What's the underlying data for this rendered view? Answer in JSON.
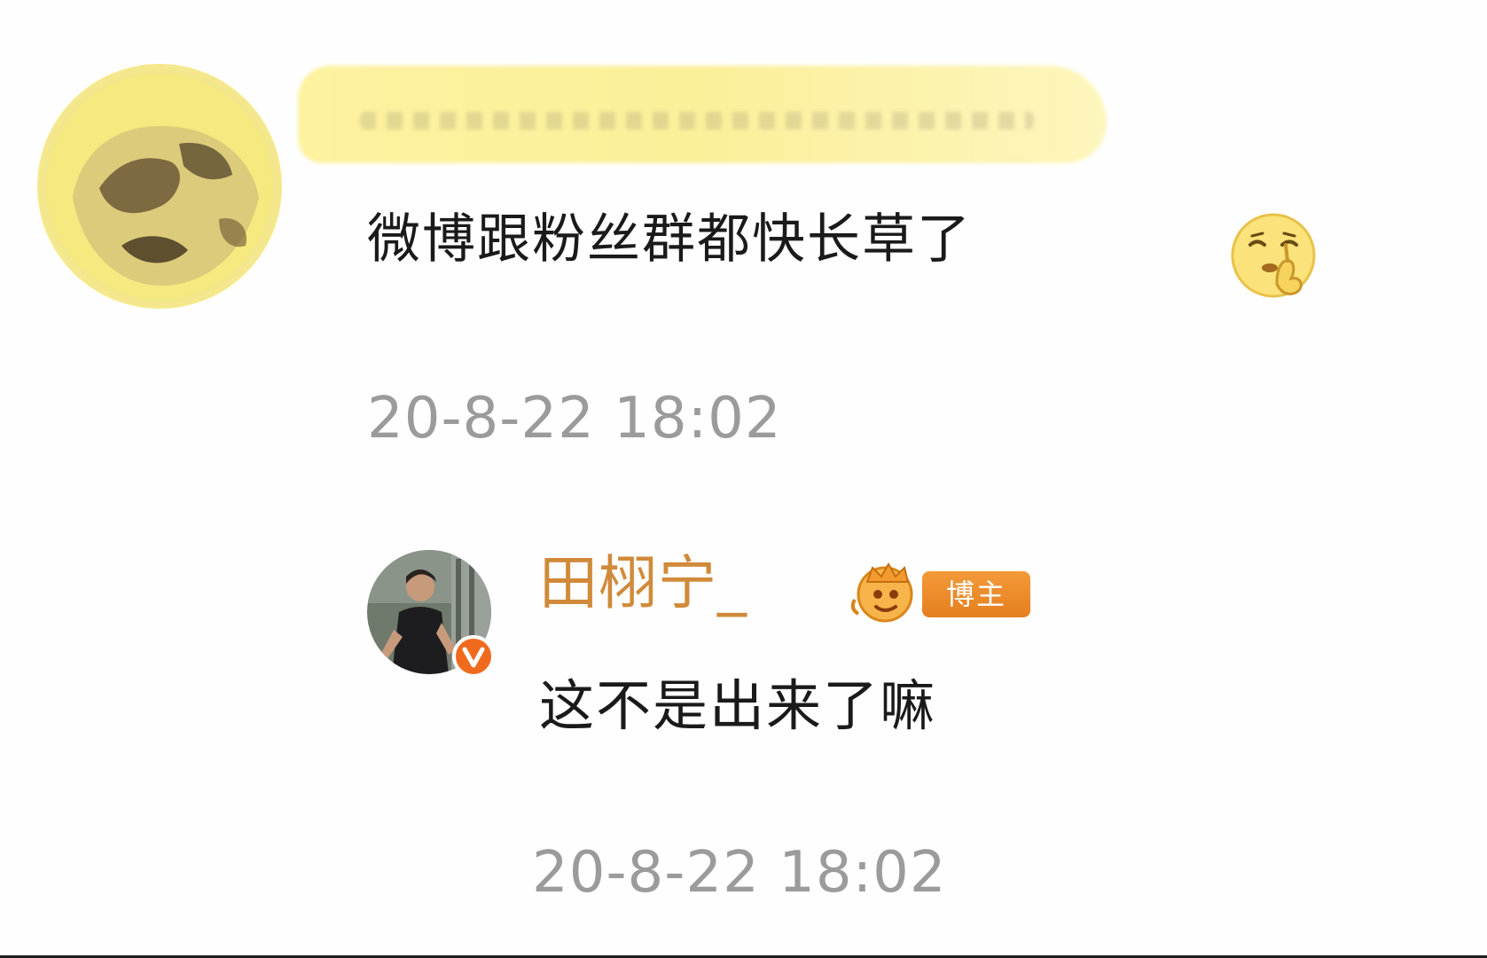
{
  "comment": {
    "username": "",
    "text": "微博跟粉丝群都快长草了",
    "emoji": "shushing-face-emoji",
    "timestamp": "20-8-22 18:02"
  },
  "reply": {
    "username": "田栩宁_",
    "badge_label": "博主",
    "badge_icon": "author-crown-icon",
    "verified_icon": "verified-v-icon",
    "text": "这不是出来了嘛",
    "timestamp": "20-8-22 18:02"
  },
  "colors": {
    "name_accent": "#d08a3a",
    "timestamp_gray": "#9b9b9b",
    "badge_orange": "#e57f1f",
    "redaction_yellow": "#fcef9a"
  }
}
